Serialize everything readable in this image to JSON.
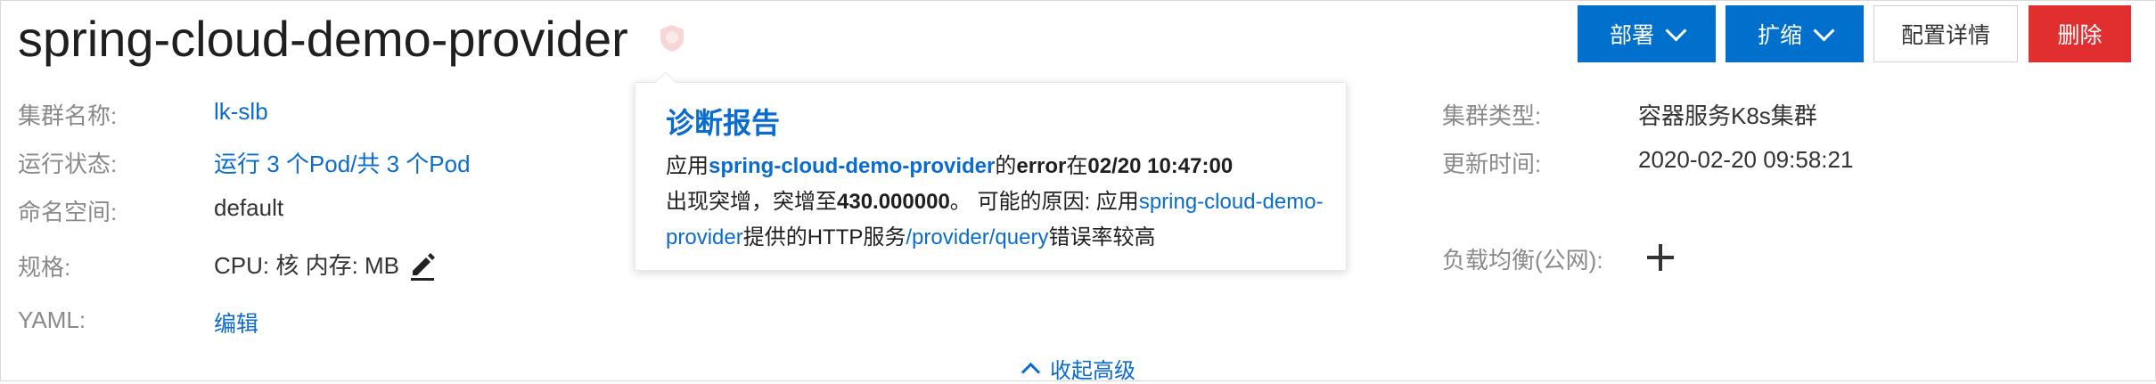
{
  "app": {
    "title": "spring-cloud-demo-provider"
  },
  "toolbar": {
    "deploy_label": "部署",
    "scale_label": "扩缩",
    "config_label": "配置详情",
    "delete_label": "删除"
  },
  "info": {
    "cluster_name_label": "集群名称:",
    "cluster_name_value": "lk-slb",
    "run_status_label": "运行状态:",
    "run_status_value": "运行 3 个Pod/共 3 个Pod",
    "namespace_label": "命名空间:",
    "namespace_value": "default",
    "spec_label": "规格:",
    "spec_value": "CPU: 核 内存: MB",
    "yaml_label": "YAML:",
    "yaml_value": "编辑",
    "cluster_type_label": "集群类型:",
    "cluster_type_value": "容器服务K8s集群",
    "update_time_label": "更新时间:",
    "update_time_value": "2020-02-20 09:58:21",
    "lb_label": "负载均衡(公网):"
  },
  "popover": {
    "title": "诊断报告",
    "t1": "应用",
    "app": "spring-cloud-demo-provider",
    "t2": "的",
    "metric": "error",
    "t3": "在",
    "time": "02/20 10:47:00",
    "t4": "出现突增，突增至",
    "value": "430.000000",
    "t5": "。 可能的原因: 应用",
    "app2": "spring-cloud-demo-provider",
    "t6": "提供的HTTP服务",
    "path": "/provider/query",
    "t7": "错误率较高"
  },
  "footer": {
    "collapse_label": "收起高级"
  },
  "colors": {
    "primary": "#0070cc",
    "danger": "#e12e2e",
    "link": "#0a6ccf"
  },
  "icons": [
    "diagnosis-shield-icon",
    "chevron-down-icon",
    "edit-pencil-icon",
    "plus-icon",
    "chevron-up-icon"
  ]
}
